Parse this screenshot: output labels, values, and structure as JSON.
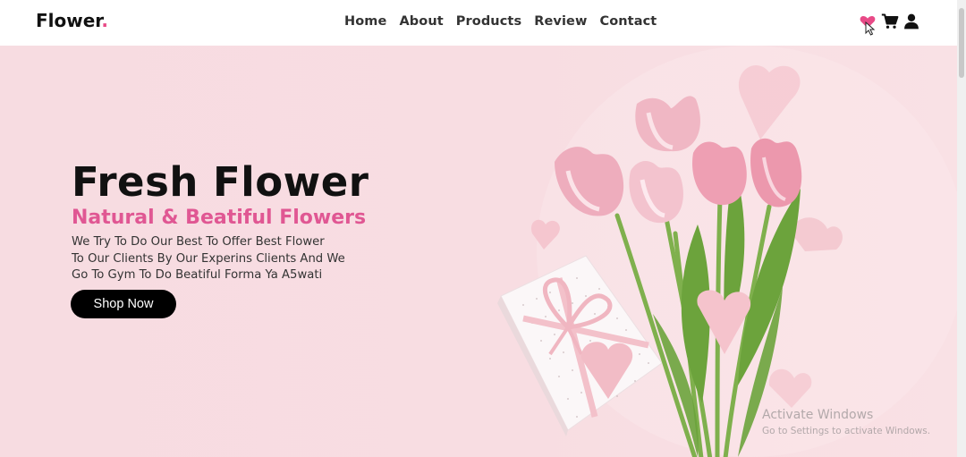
{
  "header": {
    "logo": "Flower",
    "logo_dot": ".",
    "nav": [
      "Home",
      "About",
      "Products",
      "Review",
      "Contact"
    ],
    "icons": [
      "heart-icon",
      "cart-icon",
      "user-icon"
    ]
  },
  "hero": {
    "title": "Fresh Flower",
    "subtitle": "Natural & Beatiful Flowers",
    "description_lines": [
      "We Try To Do Our Best To Offer Best Flower",
      "To Our Clients By Our Experins Clients And We",
      "Go To Gym To Do Beatiful Forma Ya A5wati"
    ],
    "button": "Shop Now"
  },
  "watermark": {
    "line1": "Activate Windows",
    "line2": "Go to Settings to activate Windows."
  },
  "colors": {
    "accent": "#e84a87",
    "subtitle": "#e05793",
    "background": "#f7dde2",
    "button": "#000000"
  }
}
